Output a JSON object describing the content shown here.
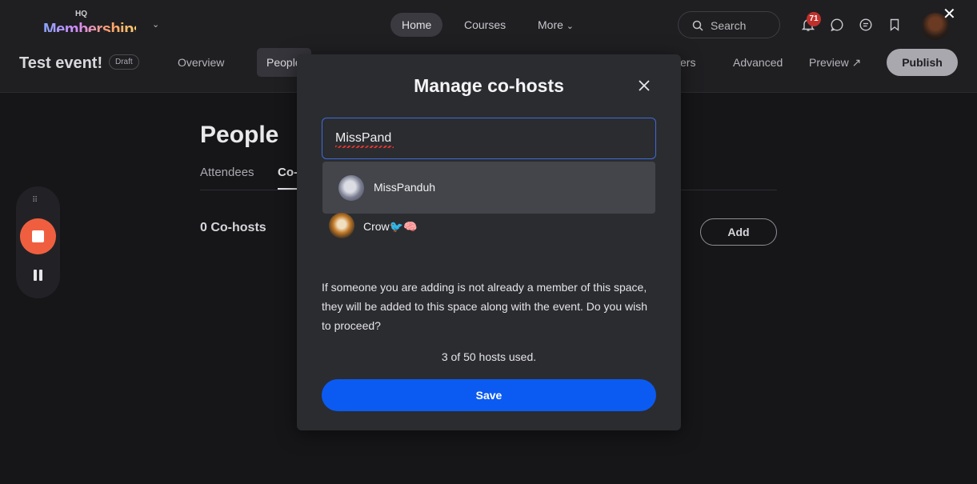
{
  "topbar": {
    "logo_small": "HQ",
    "logo_main": "Memberships",
    "nav": {
      "home": "Home",
      "courses": "Courses",
      "more": "More"
    },
    "search_label": "Search",
    "notifications_count": "71",
    "icons": [
      "bell-icon",
      "chat-bubble-icon",
      "message-icon",
      "bookmark-icon"
    ]
  },
  "event": {
    "title": "Test event!",
    "status": "Draft",
    "tabs": {
      "overview": "Overview",
      "people": "People",
      "partial": "ers",
      "advanced": "Advanced",
      "preview": "Preview ↗"
    },
    "publish_label": "Publish"
  },
  "page": {
    "heading": "People",
    "subtabs": {
      "attendees": "Attendees",
      "cohosts_partial": "Co-"
    },
    "cohosts_count": "0 Co-hosts",
    "add_label": "Add"
  },
  "recorder": {
    "grip": "⠿"
  },
  "modal": {
    "title": "Manage co-hosts",
    "search_value": "MissPand",
    "suggestion_name": "MissPanduh",
    "cohost_name": "Crow🐦🧠",
    "note": "If someone you are adding is not already a member of this space, they will be added to this space along with the event. Do you wish to proceed?",
    "hosts_used": "3 of 50 hosts used.",
    "save_label": "Save"
  },
  "colors": {
    "accent_blue": "#0b5bf2",
    "badge_red": "#c0302b",
    "record_orange": "#ef5f3f"
  }
}
